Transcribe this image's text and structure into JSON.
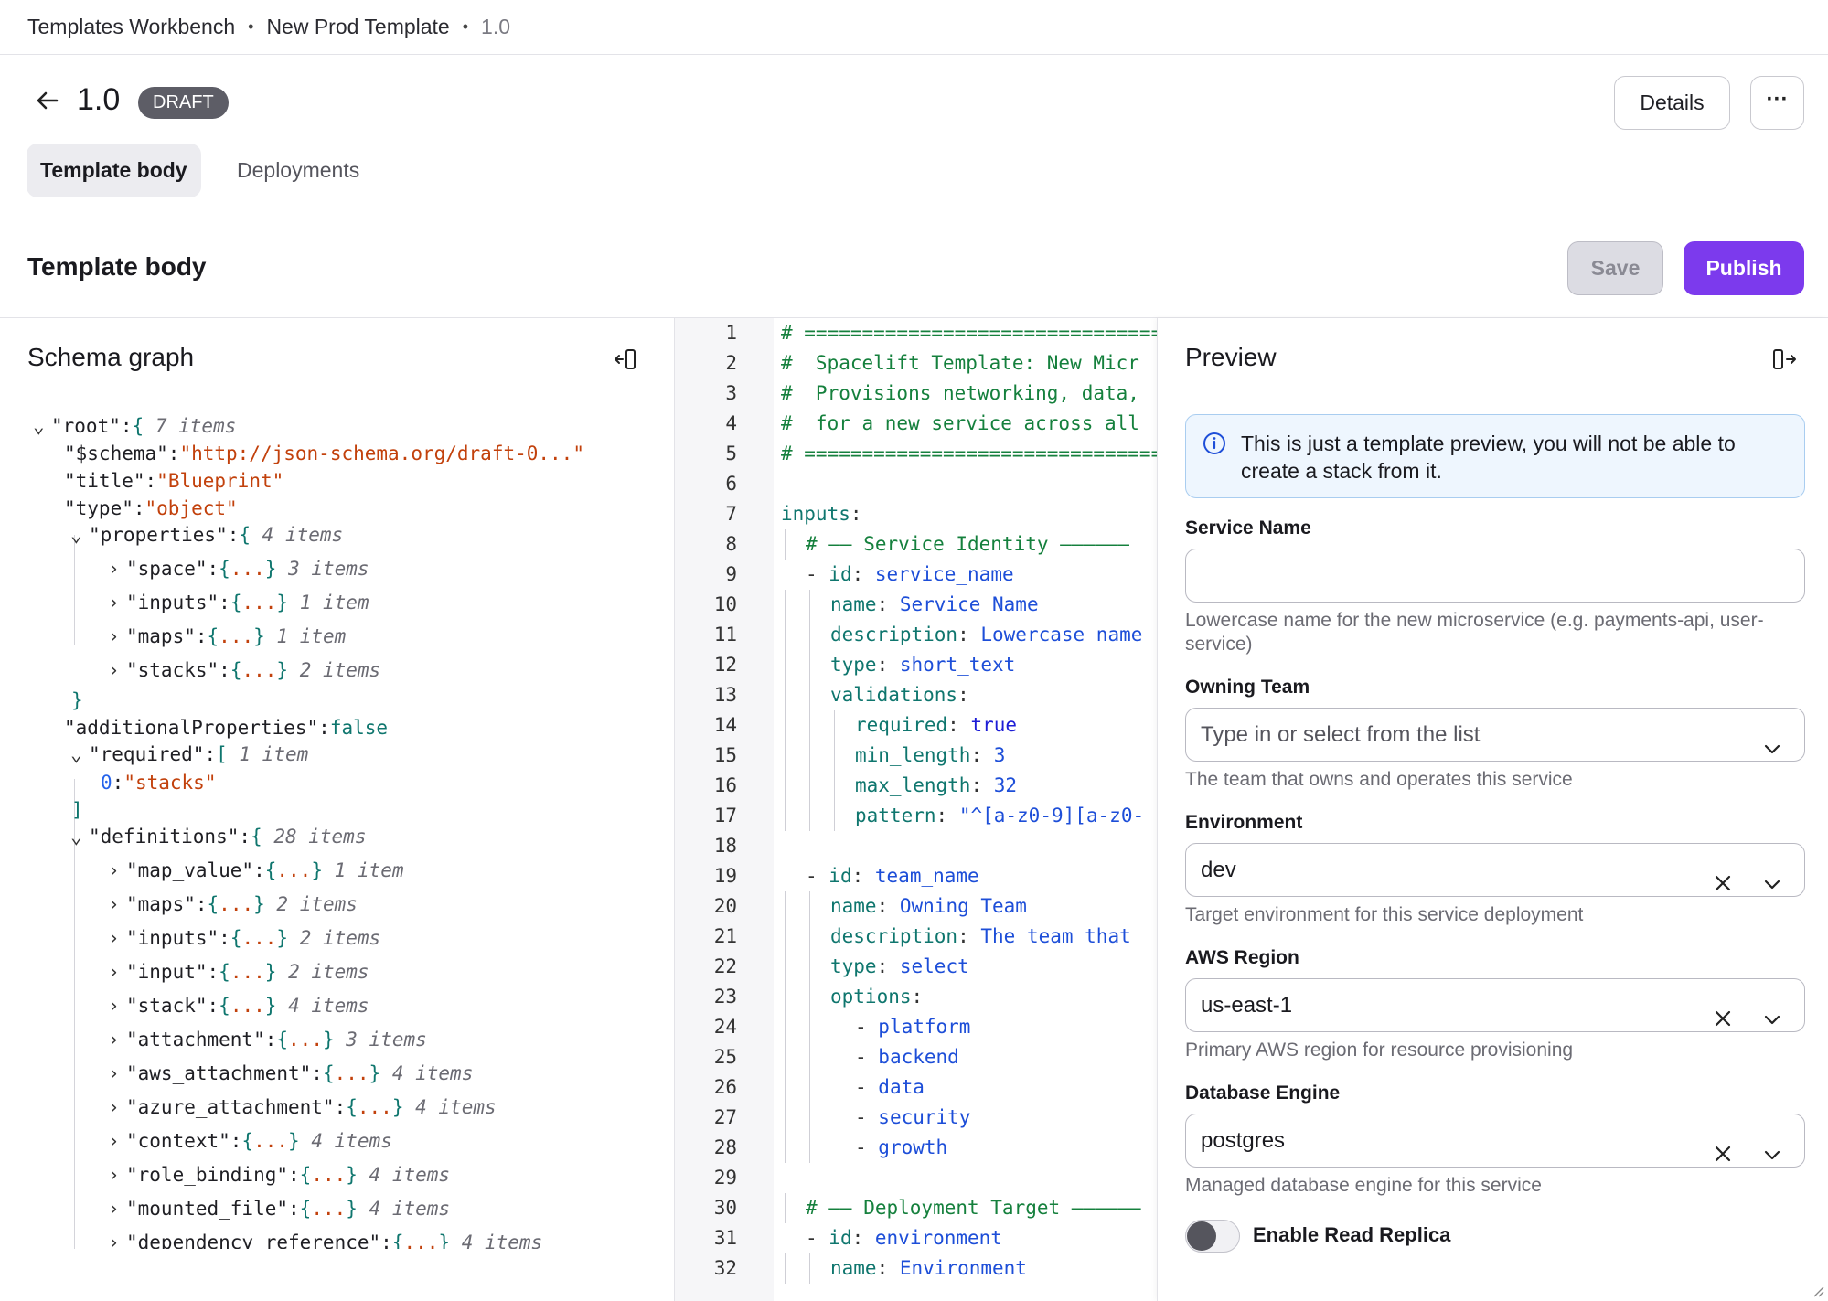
{
  "breadcrumb": {
    "items": [
      "Templates Workbench",
      "New Prod Template"
    ],
    "version": "1.0",
    "separator": "•"
  },
  "header": {
    "title": "1.0",
    "badge": "DRAFT",
    "details_label": "Details",
    "more_label": "···"
  },
  "tabs": [
    {
      "label": "Template body",
      "active": true
    },
    {
      "label": "Deployments",
      "active": false
    }
  ],
  "section": {
    "title": "Template body",
    "save_label": "Save",
    "publish_label": "Publish"
  },
  "schema": {
    "title": "Schema graph",
    "tree": {
      "root": {
        "key": "\"root\"",
        "count": "7 items"
      },
      "schema": {
        "key": "\"$schema\"",
        "value": "\"http://json-schema.org/draft-0...\""
      },
      "title": {
        "key": "\"title\"",
        "value": "\"Blueprint\""
      },
      "type": {
        "key": "\"type\"",
        "value": "\"object\""
      },
      "properties": {
        "key": "\"properties\"",
        "count": "4 items"
      },
      "properties_children": [
        {
          "key": "\"space\"",
          "count": "3 items"
        },
        {
          "key": "\"inputs\"",
          "count": "1 item"
        },
        {
          "key": "\"maps\"",
          "count": "1 item"
        },
        {
          "key": "\"stacks\"",
          "count": "2 items"
        }
      ],
      "additional": {
        "key": "\"additionalProperties\"",
        "value": "false"
      },
      "required": {
        "key": "\"required\"",
        "count": "1 item",
        "index": "0",
        "value": "\"stacks\""
      },
      "definitions": {
        "key": "\"definitions\"",
        "count": "28 items"
      },
      "definitions_children": [
        {
          "key": "\"map_value\"",
          "count": "1 item"
        },
        {
          "key": "\"maps\"",
          "count": "2 items"
        },
        {
          "key": "\"inputs\"",
          "count": "2 items"
        },
        {
          "key": "\"input\"",
          "count": "2 items"
        },
        {
          "key": "\"stack\"",
          "count": "4 items"
        },
        {
          "key": "\"attachment\"",
          "count": "3 items"
        },
        {
          "key": "\"aws_attachment\"",
          "count": "4 items"
        },
        {
          "key": "\"azure_attachment\"",
          "count": "4 items"
        },
        {
          "key": "\"context\"",
          "count": "4 items"
        },
        {
          "key": "\"role_binding\"",
          "count": "4 items"
        },
        {
          "key": "\"mounted_file\"",
          "count": "4 items"
        },
        {
          "key": "\"dependency_reference\"",
          "count": "4 items"
        }
      ]
    }
  },
  "code": {
    "lines": [
      {
        "n": "1",
        "indent": 0,
        "parts": [
          [
            "c-comment",
            "# ================================"
          ]
        ]
      },
      {
        "n": "2",
        "indent": 0,
        "parts": [
          [
            "c-comment",
            "#  Spacelift Template: New Micr"
          ]
        ]
      },
      {
        "n": "3",
        "indent": 0,
        "parts": [
          [
            "c-comment",
            "#  Provisions networking, data,"
          ]
        ]
      },
      {
        "n": "4",
        "indent": 0,
        "parts": [
          [
            "c-comment",
            "#  for a new service across all"
          ]
        ]
      },
      {
        "n": "5",
        "indent": 0,
        "parts": [
          [
            "c-comment",
            "# ================================"
          ]
        ]
      },
      {
        "n": "6",
        "indent": 0,
        "parts": []
      },
      {
        "n": "7",
        "indent": 0,
        "parts": [
          [
            "c-key",
            "inputs"
          ],
          [
            "c-dash",
            ":"
          ]
        ]
      },
      {
        "n": "8",
        "indent": 1,
        "parts": [
          [
            "c-comment",
            "# —— Service Identity ——————"
          ]
        ]
      },
      {
        "n": "9",
        "indent": 1,
        "parts": [
          [
            "c-dash",
            "- "
          ],
          [
            "c-key",
            "id"
          ],
          [
            "c-dash",
            ": "
          ],
          [
            "c-val",
            "service_name"
          ]
        ]
      },
      {
        "n": "10",
        "indent": 2,
        "parts": [
          [
            "c-key",
            "name"
          ],
          [
            "c-dash",
            ": "
          ],
          [
            "c-val",
            "Service Name"
          ]
        ]
      },
      {
        "n": "11",
        "indent": 2,
        "parts": [
          [
            "c-key",
            "description"
          ],
          [
            "c-dash",
            ": "
          ],
          [
            "c-val",
            "Lowercase name"
          ]
        ]
      },
      {
        "n": "12",
        "indent": 2,
        "parts": [
          [
            "c-key",
            "type"
          ],
          [
            "c-dash",
            ": "
          ],
          [
            "c-val",
            "short_text"
          ]
        ]
      },
      {
        "n": "13",
        "indent": 2,
        "parts": [
          [
            "c-key",
            "validations"
          ],
          [
            "c-dash",
            ":"
          ]
        ]
      },
      {
        "n": "14",
        "indent": 3,
        "parts": [
          [
            "c-key",
            "required"
          ],
          [
            "c-dash",
            ": "
          ],
          [
            "c-bool",
            "true"
          ]
        ]
      },
      {
        "n": "15",
        "indent": 3,
        "parts": [
          [
            "c-key",
            "min_length"
          ],
          [
            "c-dash",
            ": "
          ],
          [
            "c-val",
            "3"
          ]
        ]
      },
      {
        "n": "16",
        "indent": 3,
        "parts": [
          [
            "c-key",
            "max_length"
          ],
          [
            "c-dash",
            ": "
          ],
          [
            "c-val",
            "32"
          ]
        ]
      },
      {
        "n": "17",
        "indent": 3,
        "parts": [
          [
            "c-key",
            "pattern"
          ],
          [
            "c-dash",
            ": "
          ],
          [
            "c-val",
            "\"^[a-z0-9][a-z0-"
          ]
        ]
      },
      {
        "n": "18",
        "indent": 0,
        "parts": []
      },
      {
        "n": "19",
        "indent": 1,
        "parts": [
          [
            "c-dash",
            "- "
          ],
          [
            "c-key",
            "id"
          ],
          [
            "c-dash",
            ": "
          ],
          [
            "c-val",
            "team_name"
          ]
        ]
      },
      {
        "n": "20",
        "indent": 2,
        "parts": [
          [
            "c-key",
            "name"
          ],
          [
            "c-dash",
            ": "
          ],
          [
            "c-val",
            "Owning Team"
          ]
        ]
      },
      {
        "n": "21",
        "indent": 2,
        "parts": [
          [
            "c-key",
            "description"
          ],
          [
            "c-dash",
            ": "
          ],
          [
            "c-val",
            "The team that"
          ]
        ]
      },
      {
        "n": "22",
        "indent": 2,
        "parts": [
          [
            "c-key",
            "type"
          ],
          [
            "c-dash",
            ": "
          ],
          [
            "c-val",
            "select"
          ]
        ]
      },
      {
        "n": "23",
        "indent": 2,
        "parts": [
          [
            "c-key",
            "options"
          ],
          [
            "c-dash",
            ":"
          ]
        ]
      },
      {
        "n": "24",
        "indent": 3,
        "parts": [
          [
            "c-dash",
            "- "
          ],
          [
            "c-val",
            "platform"
          ]
        ]
      },
      {
        "n": "25",
        "indent": 3,
        "parts": [
          [
            "c-dash",
            "- "
          ],
          [
            "c-val",
            "backend"
          ]
        ]
      },
      {
        "n": "26",
        "indent": 3,
        "parts": [
          [
            "c-dash",
            "- "
          ],
          [
            "c-val",
            "data"
          ]
        ]
      },
      {
        "n": "27",
        "indent": 3,
        "parts": [
          [
            "c-dash",
            "- "
          ],
          [
            "c-val",
            "security"
          ]
        ]
      },
      {
        "n": "28",
        "indent": 3,
        "parts": [
          [
            "c-dash",
            "- "
          ],
          [
            "c-val",
            "growth"
          ]
        ]
      },
      {
        "n": "29",
        "indent": 0,
        "parts": []
      },
      {
        "n": "30",
        "indent": 1,
        "parts": [
          [
            "c-comment",
            "# —— Deployment Target ——————"
          ]
        ]
      },
      {
        "n": "31",
        "indent": 1,
        "parts": [
          [
            "c-dash",
            "- "
          ],
          [
            "c-key",
            "id"
          ],
          [
            "c-dash",
            ": "
          ],
          [
            "c-val",
            "environment"
          ]
        ]
      },
      {
        "n": "32",
        "indent": 2,
        "parts": [
          [
            "c-key",
            "name"
          ],
          [
            "c-dash",
            ": "
          ],
          [
            "c-val",
            "Environment"
          ]
        ]
      }
    ]
  },
  "preview": {
    "title": "Preview",
    "info": "This is just a template preview, you will not be able to create a stack from it.",
    "fields": {
      "service_name": {
        "label": "Service Name",
        "value": "",
        "help": "Lowercase name for the new microservice (e.g. payments-api, user-service)"
      },
      "owning_team": {
        "label": "Owning Team",
        "placeholder": "Type in or select from the list",
        "help": "The team that owns and operates this service"
      },
      "environment": {
        "label": "Environment",
        "value": "dev",
        "help": "Target environment for this service deployment"
      },
      "aws_region": {
        "label": "AWS Region",
        "value": "us-east-1",
        "help": "Primary AWS region for resource provisioning"
      },
      "database_engine": {
        "label": "Database Engine",
        "value": "postgres",
        "help": "Managed database engine for this service"
      },
      "read_replica": {
        "label": "Enable Read Replica",
        "enabled": false
      }
    }
  },
  "colors": {
    "accent": "#7c3aed",
    "info_bg": "#eef6fe",
    "info_border": "#a9cdf0"
  }
}
